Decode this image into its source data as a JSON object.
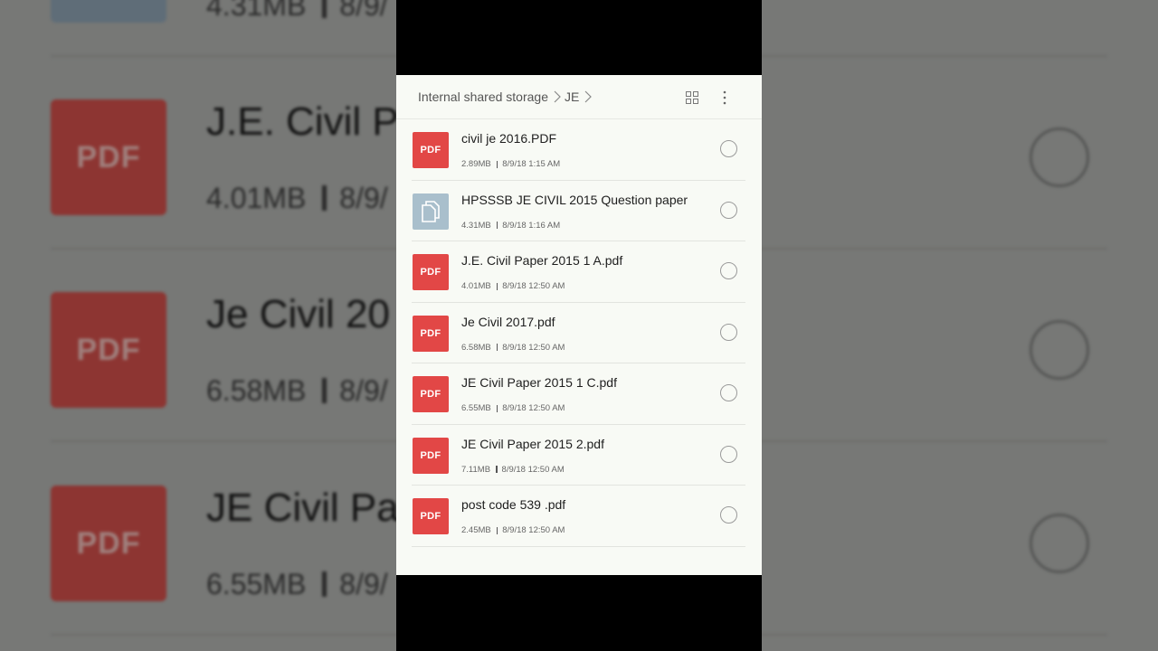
{
  "background": {
    "rows": [
      {
        "name": "",
        "size": "4.31MB",
        "date": "8/9/",
        "icon": "",
        "doc": true
      },
      {
        "name": "J.E. Civil Pa",
        "size": "4.01MB",
        "date": "8/9/",
        "icon": "PDF",
        "doc": false
      },
      {
        "name": "Je Civil 20",
        "size": "6.58MB",
        "date": "8/9/",
        "icon": "PDF",
        "doc": false
      },
      {
        "name": "JE Civil Pa",
        "size": "6.55MB",
        "date": "8/9/",
        "icon": "PDF",
        "doc": false
      }
    ]
  },
  "header": {
    "breadcrumb_root": "Internal shared storage",
    "breadcrumb_current": "JE",
    "grid_icon": "grid-view-icon",
    "more_icon": "more-vertical-icon"
  },
  "files": [
    {
      "name": "civil je 2016.PDF",
      "size": "2.89MB",
      "date": "8/9/18 1:15 AM",
      "icon": "PDF",
      "type": "pdf"
    },
    {
      "name": "HPSSSB JE CIVIL 2015 Question paper",
      "size": "4.31MB",
      "date": "8/9/18 1:16 AM",
      "icon": "",
      "type": "doc"
    },
    {
      "name": "J.E. Civil Paper 2015 1 A.pdf",
      "size": "4.01MB",
      "date": "8/9/18 12:50 AM",
      "icon": "PDF",
      "type": "pdf"
    },
    {
      "name": "Je Civil 2017.pdf",
      "size": "6.58MB",
      "date": "8/9/18 12:50 AM",
      "icon": "PDF",
      "type": "pdf"
    },
    {
      "name": "JE Civil Paper 2015 1 C.pdf",
      "size": "6.55MB",
      "date": "8/9/18 12:50 AM",
      "icon": "PDF",
      "type": "pdf"
    },
    {
      "name": "JE Civil Paper 2015 2.pdf",
      "size": "7.11MB",
      "date": "8/9/18 12:50 AM",
      "icon": "PDF",
      "type": "pdf"
    },
    {
      "name": "post code 539 .pdf",
      "size": "2.45MB",
      "date": "8/9/18 12:50 AM",
      "icon": "PDF",
      "type": "pdf"
    }
  ],
  "colors": {
    "pdf": "#e24746",
    "doc": "#a9bfcc",
    "screen": "#f8faf5"
  }
}
